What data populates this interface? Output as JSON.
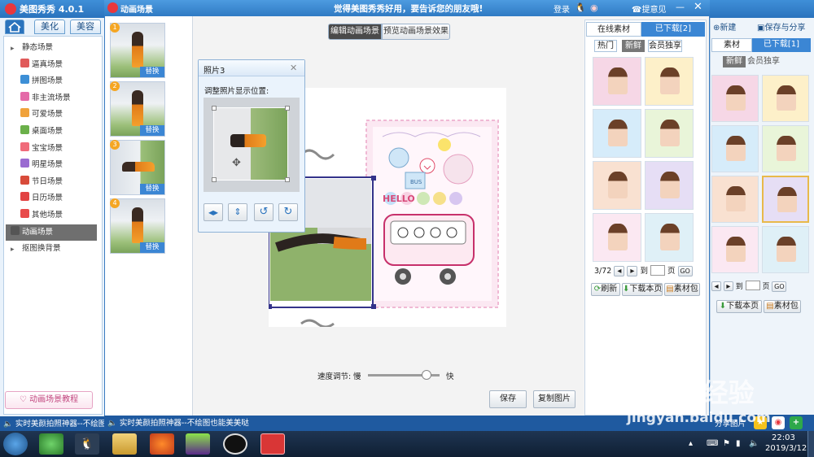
{
  "main_app": {
    "title": "美图秀秀 4.0.1",
    "tabs": [
      "美化",
      "美容"
    ],
    "tree": [
      {
        "label": "静态场景",
        "color": "#8e8e8e",
        "type": "expand"
      },
      {
        "label": "逼真场景",
        "color": "#e05a5a"
      },
      {
        "label": "拼图场景",
        "color": "#3d8fd6"
      },
      {
        "label": "非主流场景",
        "color": "#e46aa8"
      },
      {
        "label": "可爱场景",
        "color": "#f0a23b"
      },
      {
        "label": "桌面场景",
        "color": "#6bb04a"
      },
      {
        "label": "宝宝场景",
        "color": "#f06b7a"
      },
      {
        "label": "明星场景",
        "color": "#9a6bd1"
      },
      {
        "label": "节日场景",
        "color": "#d84b3a"
      },
      {
        "label": "日历场景",
        "color": "#e24343"
      },
      {
        "label": "其他场景",
        "color": "#e84a4a"
      },
      {
        "label": "动画场景",
        "color": "#555",
        "type": "selected"
      },
      {
        "label": "抠图换背景",
        "color": "#8e8e8e",
        "type": "expand"
      }
    ],
    "tutorial": "动画场景教程",
    "status": "实时美颜拍照神器--不绘图",
    "right": {
      "buttons": [
        "新建",
        "保存与分享"
      ],
      "tabs": [
        "素材",
        "已下载[1]"
      ],
      "filters": [
        "新鲜",
        "会员独享"
      ],
      "page_suffix": "页",
      "go": "GO",
      "actions": [
        "下载本页",
        "素材包"
      ],
      "share": "分享图片"
    }
  },
  "modal": {
    "title": "动画场景",
    "banner": "觉得美图秀秀好用，要告诉您的朋友哦!",
    "top_links": [
      "登录",
      "提意见"
    ],
    "thumbs": [
      {
        "num": "1",
        "label": "替换"
      },
      {
        "num": "2",
        "label": "替换"
      },
      {
        "num": "3",
        "label": "替换"
      },
      {
        "num": "4",
        "label": "替换"
      }
    ],
    "mode_tabs": [
      "编辑动画场景",
      "预览动画场景效果"
    ],
    "photo_panel": {
      "title": "照片3",
      "hint": "调整照片显示位置:"
    },
    "speed": {
      "label": "速度调节:",
      "slow": "慢",
      "fast": "快",
      "value": 0.82
    },
    "save": "保存",
    "copy": "复制图片",
    "status": "实时美颜拍照神器--不绘图也能美美哒",
    "material": {
      "tabs": [
        "在线素材",
        "已下载[2]"
      ],
      "filters": [
        "热门",
        "新鲜",
        "会员独享"
      ],
      "page_info": "3/72",
      "goto": "到",
      "page_suffix": "页",
      "go": "GO",
      "actions": [
        "刷新",
        "下载本页",
        "素材包"
      ]
    },
    "stage_text": {
      "bubble_text": "HELLO",
      "bus": "BUS"
    }
  },
  "taskbar": {
    "time": "22:03",
    "date": "2019/3/12"
  },
  "watermark": {
    "logo": "Baidu经验",
    "url": "jingyan.baidu.com"
  },
  "colors": {
    "accent": "#2a73bd",
    "title_blue": "#2f7ac3",
    "stage_pink": "#f5c7de"
  }
}
